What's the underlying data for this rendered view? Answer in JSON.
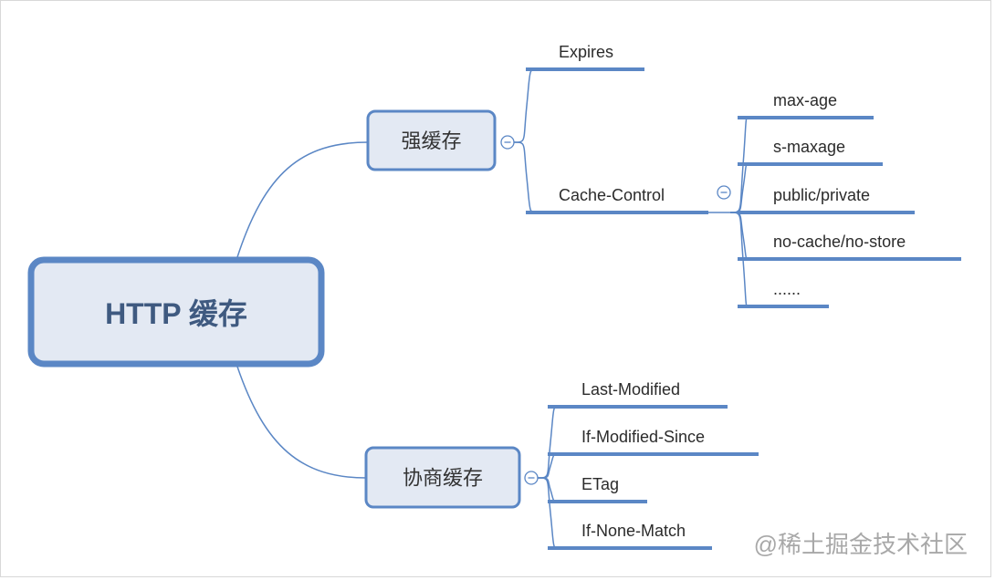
{
  "root": {
    "label": "HTTP 缓存"
  },
  "branches": [
    {
      "label": "强缓存",
      "children": [
        {
          "label": "Expires",
          "children": []
        },
        {
          "label": "Cache-Control",
          "children": [
            {
              "label": "max-age"
            },
            {
              "label": "s-maxage"
            },
            {
              "label": "public/private"
            },
            {
              "label": "no-cache/no-store"
            },
            {
              "label": "......"
            }
          ]
        }
      ]
    },
    {
      "label": "协商缓存",
      "children": [
        {
          "label": "Last-Modified"
        },
        {
          "label": "If-Modified-Since"
        },
        {
          "label": "ETag"
        },
        {
          "label": "If-None-Match"
        }
      ]
    }
  ],
  "watermark": "@稀土掘金技术社区",
  "colors": {
    "line": "#5b87c5",
    "node_fill": "#e3e9f3",
    "root_text": "#3f5a80"
  }
}
